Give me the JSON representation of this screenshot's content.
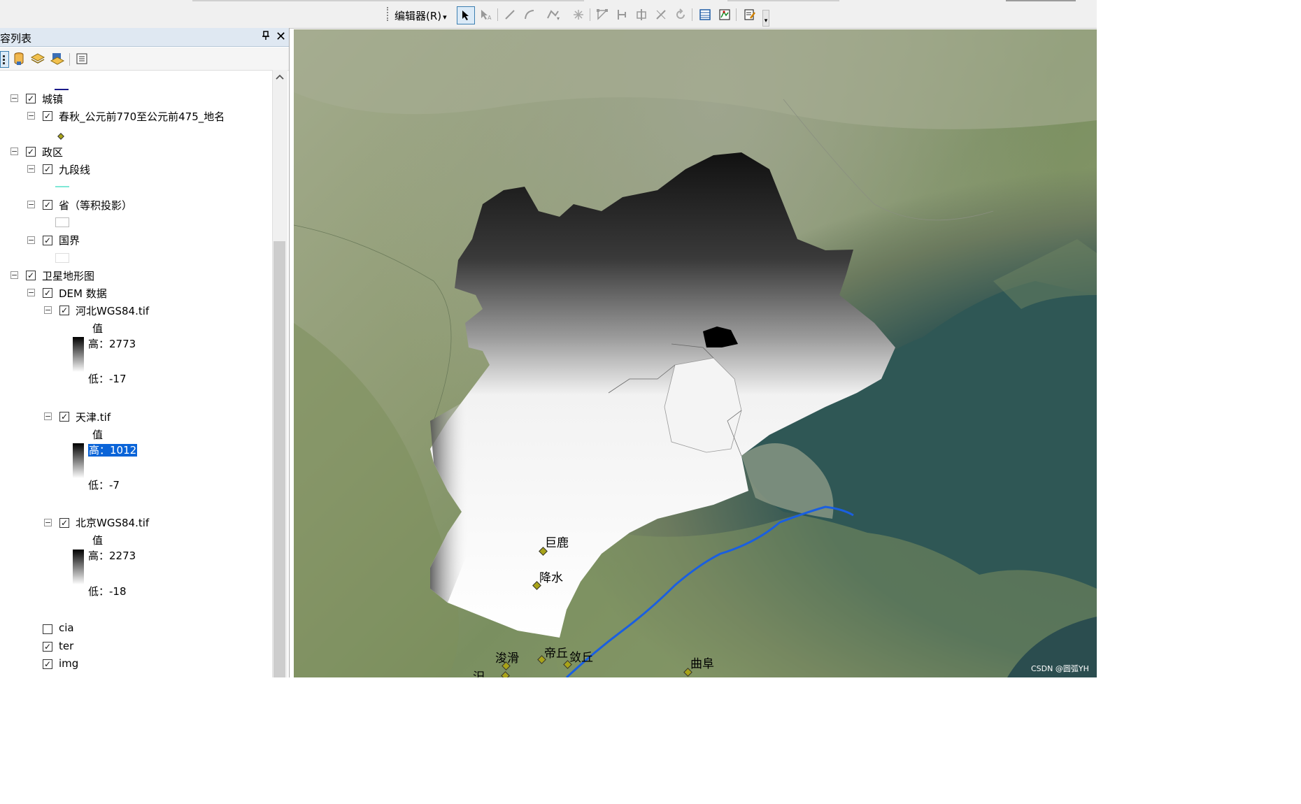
{
  "toolbar": {
    "editor_label": "编辑器(R)",
    "editor_arrow": "▾",
    "buttons": [
      "edit-tool",
      "edit-annotation",
      "straight-segment",
      "end-point-arc",
      "trace",
      "point",
      "edit-vertices",
      "reshape",
      "cut-polygons",
      "split",
      "rotate",
      "attributes",
      "sketch-properties",
      "create-features"
    ]
  },
  "toc": {
    "title": "容列表",
    "pin": "ᴾ",
    "close": "✕",
    "groups": {
      "town": {
        "label": "城镇",
        "checked": true
      },
      "chunqiu": {
        "label": "春秋_公元前770至公元前475_地名",
        "checked": true
      },
      "admin": {
        "label": "政区",
        "checked": true
      },
      "nine_dash": {
        "label": "九段线",
        "checked": true
      },
      "province": {
        "label": "省（等积投影）",
        "checked": true
      },
      "border": {
        "label": "国界",
        "checked": true
      },
      "sat": {
        "label": "卫星地形图",
        "checked": true
      },
      "dem": {
        "label": "DEM 数据",
        "checked": true
      },
      "hebei": {
        "label": "河北WGS84.tif",
        "checked": true,
        "value_title": "值",
        "high": "高：2773",
        "low": "低：-17"
      },
      "tianjin": {
        "label": "天津.tif",
        "checked": true,
        "value_title": "值",
        "high": "高：1012",
        "low": "低：-7"
      },
      "beijing": {
        "label": "北京WGS84.tif",
        "checked": true,
        "value_title": "值",
        "high": "高：2273",
        "low": "低：-18"
      },
      "cia": {
        "label": "cia",
        "checked": false
      },
      "ter": {
        "label": "ter",
        "checked": true
      },
      "img": {
        "label": "img",
        "checked": true
      }
    },
    "colors": {
      "nine_dash_line": "#7fe8d6",
      "top_line": "#1a1a8a",
      "town_point": "#a8a318"
    }
  },
  "map": {
    "places": {
      "julu": "巨鹿",
      "jiangshui": "降水",
      "diqiu": "帝丘",
      "liqiu": "敛丘",
      "junhua": "浚滑",
      "qufu": "曲阜",
      "si": "汜"
    },
    "river_color": "#1a5fe0",
    "watermark": "CSDN @圆弧YH"
  }
}
